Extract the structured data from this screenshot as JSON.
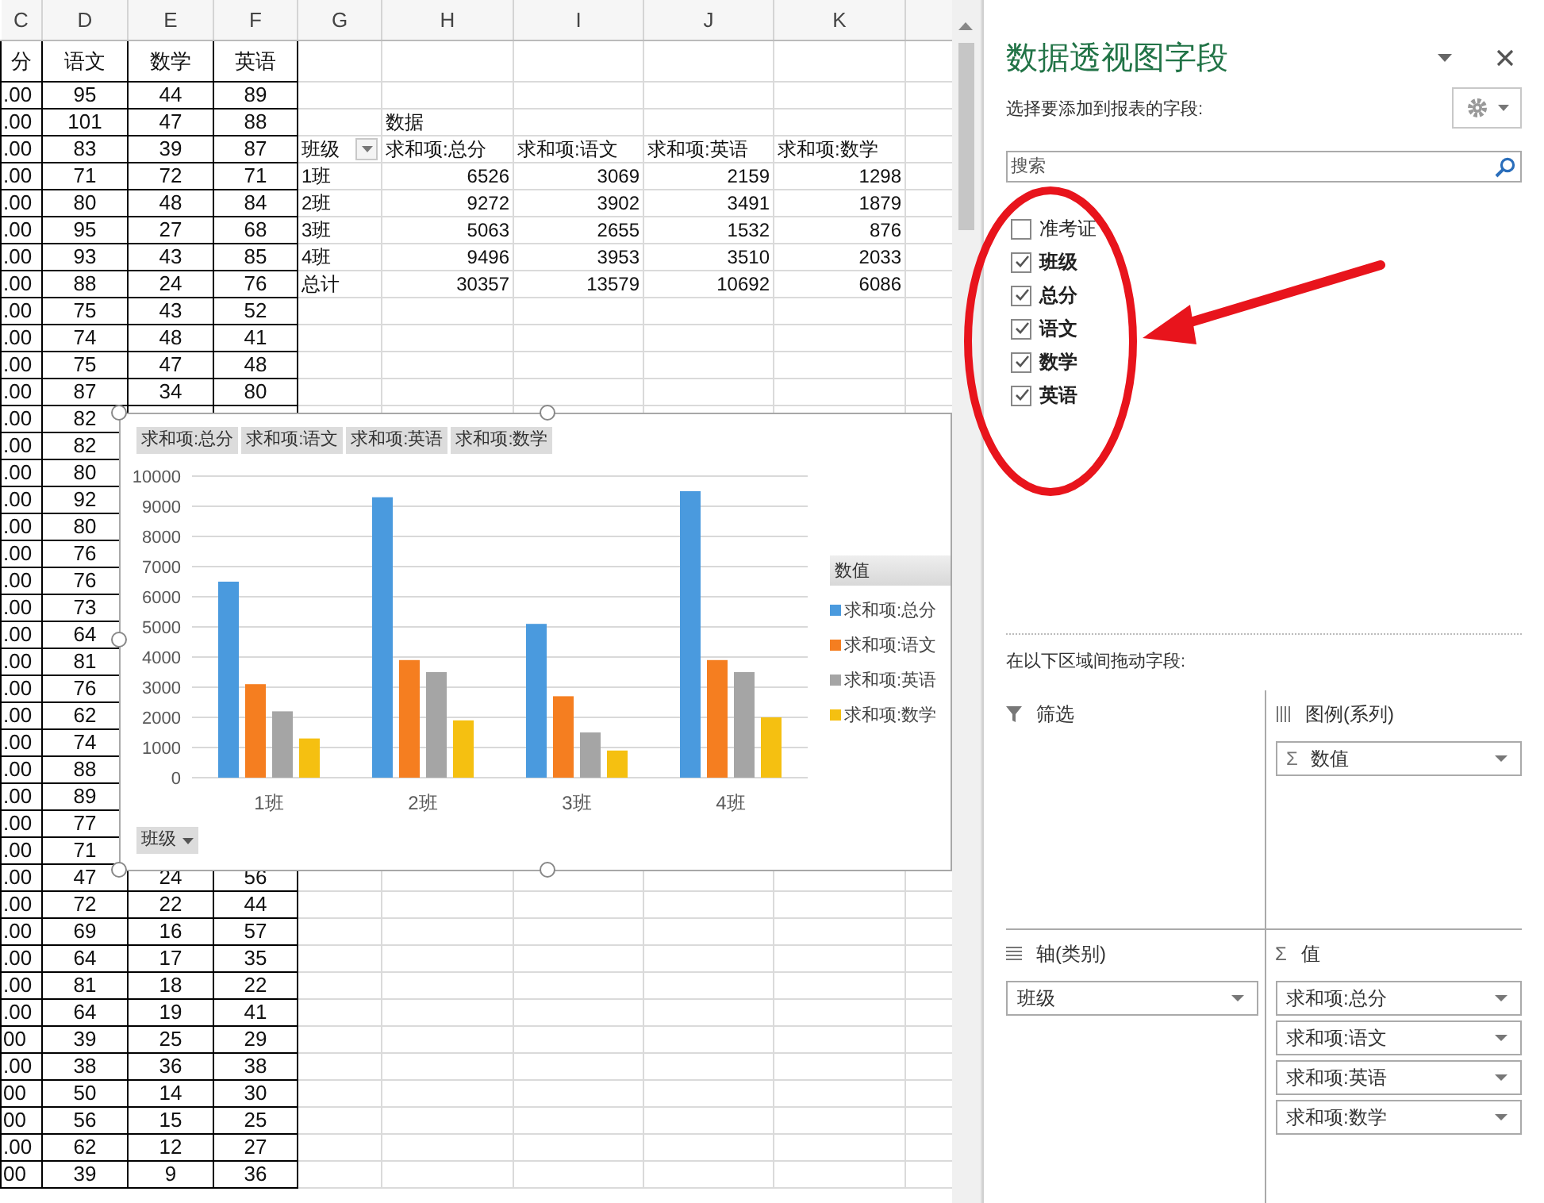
{
  "sheet": {
    "column_letters": [
      "C",
      "D",
      "E",
      "F",
      "G",
      "H",
      "I",
      "J",
      "K"
    ],
    "header_row": [
      "分",
      "语文",
      "数学",
      "英语"
    ],
    "rows": [
      {
        "c": ".00",
        "d": "95",
        "e": "44",
        "f": "89"
      },
      {
        "c": ".00",
        "d": "101",
        "e": "47",
        "f": "88"
      },
      {
        "c": ".00",
        "d": "83",
        "e": "39",
        "f": "87"
      },
      {
        "c": ".00",
        "d": "71",
        "e": "72",
        "f": "71"
      },
      {
        "c": ".00",
        "d": "80",
        "e": "48",
        "f": "84"
      },
      {
        "c": ".00",
        "d": "95",
        "e": "27",
        "f": "68"
      },
      {
        "c": ".00",
        "d": "93",
        "e": "43",
        "f": "85"
      },
      {
        "c": ".00",
        "d": "88",
        "e": "24",
        "f": "76"
      },
      {
        "c": ".00",
        "d": "75",
        "e": "43",
        "f": "52"
      },
      {
        "c": ".00",
        "d": "74",
        "e": "48",
        "f": "41"
      },
      {
        "c": ".00",
        "d": "75",
        "e": "47",
        "f": "48"
      },
      {
        "c": ".00",
        "d": "87",
        "e": "34",
        "f": "80"
      },
      {
        "c": ".00",
        "d": "82"
      },
      {
        "c": ".00",
        "d": "82"
      },
      {
        "c": ".00",
        "d": "80"
      },
      {
        "c": ".00",
        "d": "92"
      },
      {
        "c": ".00",
        "d": "80"
      },
      {
        "c": ".00",
        "d": "76"
      },
      {
        "c": ".00",
        "d": "76"
      },
      {
        "c": ".00",
        "d": "73"
      },
      {
        "c": ".00",
        "d": "64"
      },
      {
        "c": ".00",
        "d": "81"
      },
      {
        "c": ".00",
        "d": "76"
      },
      {
        "c": ".00",
        "d": "62"
      },
      {
        "c": ".00",
        "d": "74"
      },
      {
        "c": ".00",
        "d": "88"
      },
      {
        "c": ".00",
        "d": "89"
      },
      {
        "c": ".00",
        "d": "77"
      },
      {
        "c": ".00",
        "d": "71"
      },
      {
        "c": ".00",
        "d": "47",
        "e": "24",
        "f": "56"
      },
      {
        "c": ".00",
        "d": "72",
        "e": "22",
        "f": "44"
      },
      {
        "c": ".00",
        "d": "69",
        "e": "16",
        "f": "57"
      },
      {
        "c": ".00",
        "d": "64",
        "e": "17",
        "f": "35"
      },
      {
        "c": ".00",
        "d": "81",
        "e": "18",
        "f": "22"
      },
      {
        "c": ".00",
        "d": "64",
        "e": "19",
        "f": "41"
      },
      {
        "c": "00",
        "d": "39",
        "e": "25",
        "f": "29"
      },
      {
        "c": ".00",
        "d": "38",
        "e": "36",
        "f": "38"
      },
      {
        "c": "00",
        "d": "50",
        "e": "14",
        "f": "30"
      },
      {
        "c": "00",
        "d": "56",
        "e": "15",
        "f": "25"
      },
      {
        "c": ".00",
        "d": "62",
        "e": "12",
        "f": "27"
      },
      {
        "c": "00",
        "d": "39",
        "e": "9",
        "f": "36"
      }
    ]
  },
  "pivot_table": {
    "data_label": "数据",
    "row_header": "班级",
    "columns": [
      "求和项:总分",
      "求和项:语文",
      "求和项:英语",
      "求和项:数学"
    ],
    "rows": [
      {
        "label": "1班",
        "values": [
          "6526",
          "3069",
          "2159",
          "1298"
        ]
      },
      {
        "label": "2班",
        "values": [
          "9272",
          "3902",
          "3491",
          "1879"
        ]
      },
      {
        "label": "3班",
        "values": [
          "5063",
          "2655",
          "1532",
          "876"
        ]
      },
      {
        "label": "4班",
        "values": [
          "9496",
          "3953",
          "3510",
          "2033"
        ]
      },
      {
        "label": "总计",
        "values": [
          "30357",
          "13579",
          "10692",
          "6086"
        ]
      }
    ]
  },
  "pivot_chart": {
    "field_buttons": [
      "求和项:总分",
      "求和项:语文",
      "求和项:英语",
      "求和项:数学"
    ],
    "axis_button": "班级",
    "legend_title": "数值",
    "chart_data": {
      "type": "bar",
      "grid": true,
      "categories": [
        "1班",
        "2班",
        "3班",
        "4班"
      ],
      "ylim": [
        0,
        10000
      ],
      "yticks": [
        0,
        1000,
        2000,
        3000,
        4000,
        5000,
        6000,
        7000,
        8000,
        9000,
        10000
      ],
      "series": [
        {
          "name": "求和项:总分",
          "color": "#4a9ade",
          "values": [
            6500,
            9300,
            5100,
            9500
          ]
        },
        {
          "name": "求和项:语文",
          "color": "#f57e20",
          "values": [
            3100,
            3900,
            2700,
            3900
          ]
        },
        {
          "name": "求和项:英语",
          "color": "#a5a5a5",
          "values": [
            2200,
            3500,
            1500,
            3500
          ]
        },
        {
          "name": "求和项:数学",
          "color": "#f5c011",
          "values": [
            1300,
            1900,
            900,
            2000
          ]
        }
      ]
    }
  },
  "field_pane": {
    "title": "数据透视图字段",
    "prompt": "选择要添加到报表的字段:",
    "search": {
      "placeholder": "搜索"
    },
    "fields": [
      {
        "label": "准考证",
        "checked": false
      },
      {
        "label": "班级",
        "checked": true
      },
      {
        "label": "总分",
        "checked": true
      },
      {
        "label": "语文",
        "checked": true
      },
      {
        "label": "数学",
        "checked": true
      },
      {
        "label": "英语",
        "checked": true
      }
    ],
    "drag_prompt": "在以下区域间拖动字段:",
    "areas": [
      {
        "kind": "filter",
        "label": "筛选"
      },
      {
        "kind": "legend",
        "label": "图例(系列)",
        "items": [
          {
            "prefix": "Σ",
            "label": "数值"
          }
        ]
      },
      {
        "kind": "axis",
        "label": "轴(类别)",
        "items": [
          {
            "label": "班级"
          }
        ]
      },
      {
        "kind": "values",
        "icon": "Σ",
        "label": "值",
        "items": [
          {
            "label": "求和项:总分"
          },
          {
            "label": "求和项:语文"
          },
          {
            "label": "求和项:英语"
          },
          {
            "label": "求和项:数学"
          }
        ]
      }
    ]
  }
}
